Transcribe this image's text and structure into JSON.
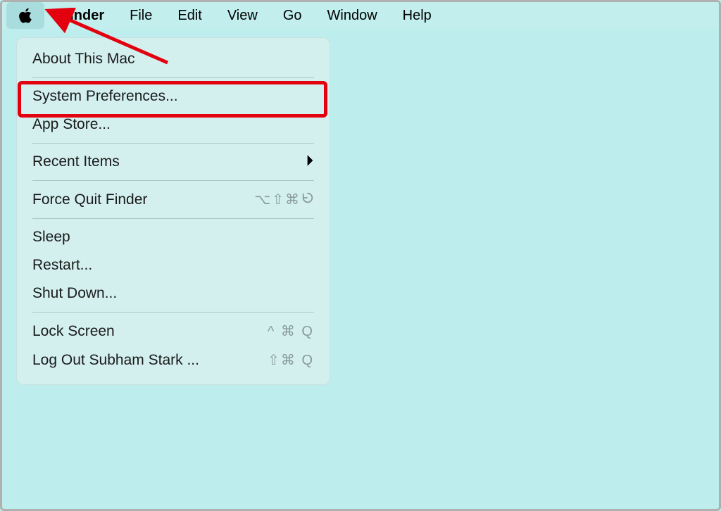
{
  "menubar": {
    "app_name": "Finder",
    "items": [
      "File",
      "Edit",
      "View",
      "Go",
      "Window",
      "Help"
    ]
  },
  "apple_menu": {
    "about": "About This Mac",
    "system_preferences": "System Preferences...",
    "app_store": "App Store...",
    "recent_items": "Recent Items",
    "force_quit": "Force Quit Finder",
    "force_quit_shortcut": "⌥⇧⌘",
    "sleep": "Sleep",
    "restart": "Restart...",
    "shut_down": "Shut Down...",
    "lock_screen": "Lock Screen",
    "lock_screen_shortcut": "^ ⌘ Q",
    "log_out": "Log Out Subham  Stark ...",
    "log_out_shortcut": "⇧⌘ Q"
  },
  "annotation": {
    "highlight_target": "system_preferences"
  }
}
